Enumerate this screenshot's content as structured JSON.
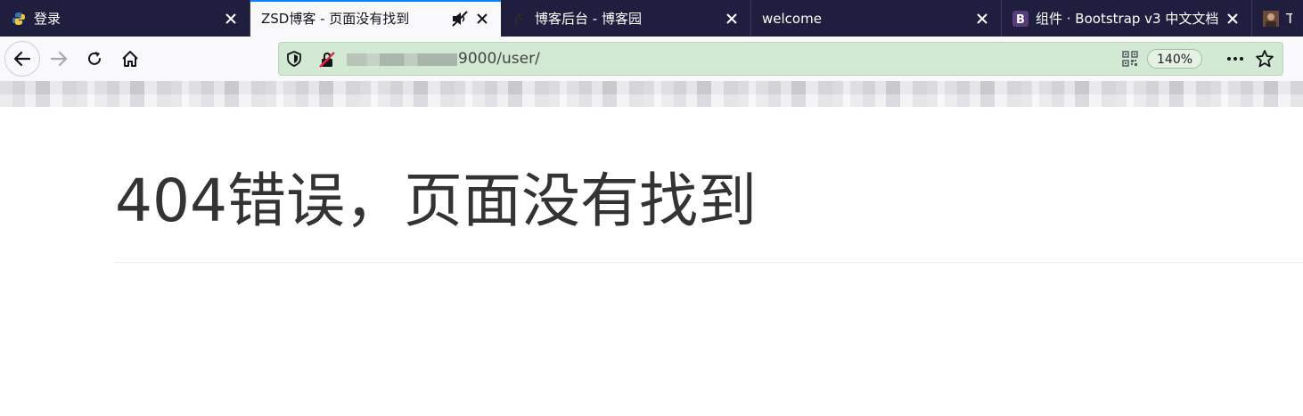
{
  "tabs": [
    {
      "title": "登录",
      "favicon": "python-logo-icon",
      "active": false
    },
    {
      "title": "ZSD博客 - 页面没有找到",
      "favicon": "",
      "active": true,
      "muted": true
    },
    {
      "title": "博客后台 - 博客园",
      "favicon": "cnblogs-logo-icon",
      "active": false
    },
    {
      "title": "welcome",
      "favicon": "",
      "active": false
    },
    {
      "title": "组件 · Bootstrap v3 中文文档",
      "favicon": "bootstrap-logo-icon",
      "active": false
    },
    {
      "title": "Th",
      "favicon": "avatar-icon",
      "active": false
    }
  ],
  "navbar": {
    "url_visible": "9000/user/",
    "zoom": "140%"
  },
  "page": {
    "heading": "404错误，页面没有找到"
  },
  "colors": {
    "tabstrip_bg": "#1f1e3f",
    "active_tab_accent": "#0a84ff",
    "urlbar_bg": "#d2e9d3",
    "heading_text": "#333333"
  }
}
